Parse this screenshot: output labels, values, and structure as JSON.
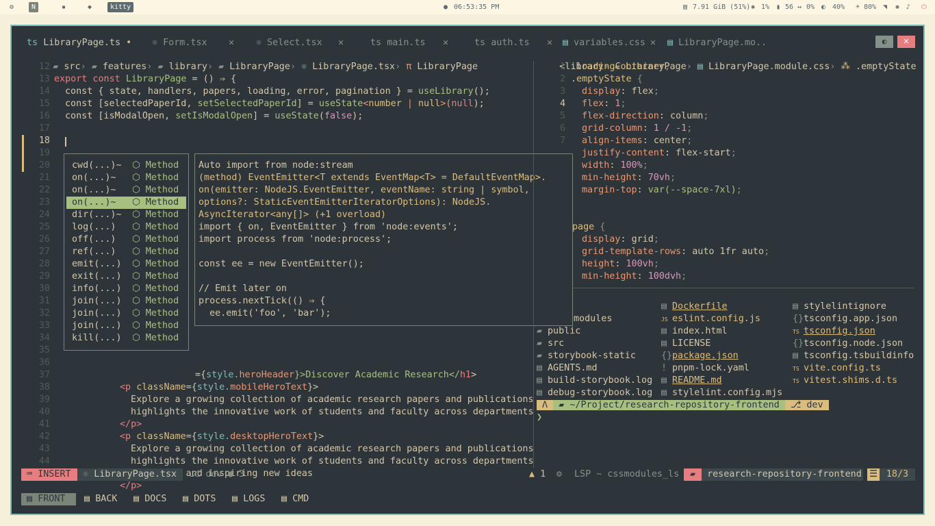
{
  "topbar": {
    "workspaces": [
      "N",
      "kitty"
    ],
    "clock": "06:53:35 PM",
    "memory": "7.91 GiB (51%)",
    "cpu": "1%",
    "temp": "56",
    "net": "0%",
    "volume": "40%",
    "brightness": "80%"
  },
  "tabs": [
    "LibraryPage.ts",
    "Form.tsx",
    "Select.tsx",
    "main.ts",
    "auth.ts",
    "variables.css",
    "LibraryPage.mo.."
  ],
  "tab_modified": "•",
  "left_breadcrumb": [
    "src",
    "features",
    "library",
    "LibraryPage",
    "LibraryPage.tsx",
    "LibraryPage"
  ],
  "right_breadcrumb": [
    "<library",
    "LibraryPage",
    "LibraryPage.module.css",
    ".emptyState"
  ],
  "code": {
    "line_numbers": [
      "12",
      "13",
      "14",
      "15",
      "16",
      "17",
      "18",
      "19",
      "20",
      "21",
      "22",
      "23",
      "24",
      "25",
      "26",
      "27",
      "28",
      "29",
      "30",
      "31",
      "32",
      "33",
      "34",
      "35",
      "36",
      "37",
      "38",
      "39",
      "40",
      "41",
      "42",
      "43",
      "44"
    ],
    "l13": [
      "export const ",
      "LibraryPage",
      " = () ⇒ {"
    ],
    "l14": [
      "const { state, handlers, papers, loading, error, pagination } = ",
      "useLibrary",
      "();"
    ],
    "l15": [
      "const [selectedPaperId, ",
      "setSelectedPaperId",
      "] = ",
      "useState",
      "<",
      "number",
      " | ",
      "null",
      ">(",
      "null",
      ");"
    ],
    "l16": [
      "const [isModalOpen, ",
      "setIsModalOpen",
      "] = ",
      "useState",
      "(",
      "false",
      ");"
    ],
    "l35": [
      "={",
      "style.",
      "heroHeader",
      "}>Discover Academic Research</",
      "h1",
      ">"
    ],
    "l36": [
      "<p ",
      "className",
      "={",
      "style.",
      "mobileHeroText",
      "}>"
    ],
    "l37": "Explore a growing collection of academic research papers and publications",
    "l38": "highlights the innovative work of students and faculty across departments",
    "l39": "</p>",
    "l40": [
      "<p ",
      "className",
      "={",
      "style.",
      "desktopHeroText",
      "}>"
    ],
    "l41": "Explore a growing collection of academic research papers and publications",
    "l42": "highlights the innovative work of students and faculty across departments",
    "l43": "knowledge and inspiring new ideas",
    "l44": "</p>"
  },
  "completion": {
    "kind": "Method",
    "items": [
      "cwd(...)~",
      "on(...)~",
      "on(...)~",
      "on(...)~",
      "dir(...)~",
      "log(...)",
      "off(...)",
      "ref(...)",
      "emit(...)",
      "exit(...)",
      "info(...)",
      "join(...)",
      "join(...)",
      "join(...)",
      "kill(...)"
    ],
    "selected_index": 3
  },
  "doc": {
    "lines": [
      "Auto import from node:stream",
      "(method) EventEmitter<T extends EventMap<T> = DefaultEventMap>.",
      "on(emitter: NodeJS.EventEmitter, eventName: string | symbol,",
      "options?: StaticEventEmitterIteratorOptions): NodeJS.",
      "AsyncIterator<any[]> (+1 overload)",
      "import { on, EventEmitter } from 'node:events';",
      "import process from 'node:process';",
      "",
      "const ee = new EventEmitter();",
      "",
      "// Emit later on",
      "process.nextTick(() ⇒ {",
      "  ee.emit('foo', 'bar');"
    ]
  },
  "css": {
    "line_numbers": [
      "1",
      "2",
      "3",
      "4",
      "5",
      "6",
      "7"
    ],
    "lines": [
      [
        ".loadingContainer",
        ","
      ],
      [
        ".emptyState",
        " {"
      ],
      [
        "display",
        ": ",
        "flex",
        ";"
      ],
      [
        "flex",
        ": ",
        "1",
        ";"
      ],
      [
        "flex-direction",
        ": ",
        "column",
        ";"
      ],
      [
        "grid-column",
        ": ",
        "1 / -1",
        ";"
      ],
      [
        "align-items",
        ": ",
        "center",
        ";"
      ],
      [
        "justify-content",
        ": ",
        "flex-start",
        ";"
      ],
      [
        "width",
        ": ",
        "100%",
        ";"
      ],
      [
        "min-height",
        ": ",
        "70vh",
        ";"
      ],
      [
        "margin-top",
        ": ",
        "var(--space-7xl)",
        ";"
      ]
    ],
    "page_lines": [
      [
        "page",
        " {"
      ],
      [
        "display",
        ": ",
        "grid",
        ";"
      ],
      [
        "grid-template-rows",
        ": ",
        "auto 1fr auto",
        ";"
      ],
      [
        "height",
        ": ",
        "100vh",
        ";"
      ],
      [
        "min-height",
        ": ",
        "100dvh",
        ";"
      ]
    ]
  },
  "files": {
    "col1": [
      "modules",
      "public",
      "src",
      "storybook-static",
      "AGENTS.md",
      "build-storybook.log",
      "debug-storybook.log"
    ],
    "col2": [
      "Dockerfile",
      "eslint.config.js",
      "index.html",
      "LICENSE",
      "package.json",
      "pnpm-lock.yaml",
      "README.md",
      "stylelint.config.mjs"
    ],
    "col3": [
      "stylelintignore",
      "tsconfig.app.json",
      "tsconfig.json",
      "tsconfig.node.json",
      "tsconfig.tsbuildinfo",
      "vite.config.ts",
      "vitest.shims.d.ts"
    ]
  },
  "prompt": {
    "path": "~/Project/research-repository-frontend",
    "branch": "dev",
    "cursor": "❯"
  },
  "status": {
    "mode": "INSERT",
    "file": "LibraryPage.tsx",
    "branch": "dev",
    "changes": "3",
    "warnings": "1",
    "lsp": "LSP ~ cssmodules_ls",
    "project": "research-repository-frontend",
    "position": "18/3"
  },
  "bottom_tabs": [
    "FRONT",
    "BACK",
    "DOCS",
    "DOTS",
    "LOGS",
    "CMD"
  ],
  "colors": {
    "accent": "#a7c080",
    "border": "#7fbbb3",
    "bg": "#2d353b",
    "insert": "#e67e80",
    "close": "#e67e80"
  }
}
